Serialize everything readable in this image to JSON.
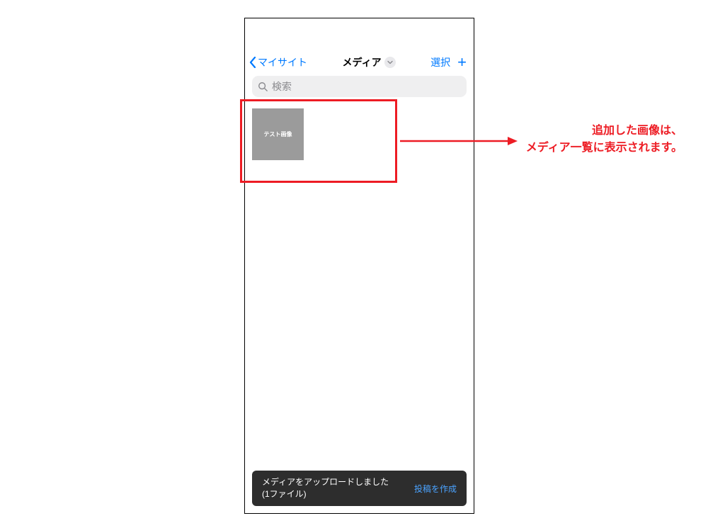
{
  "nav": {
    "back_label": "マイサイト",
    "title": "メディア",
    "select_label": "選択"
  },
  "search": {
    "placeholder": "検索"
  },
  "media": {
    "items": [
      {
        "thumb_label": "テスト画像"
      }
    ]
  },
  "toast": {
    "message_line1": "メディアをアップロードしました",
    "message_line2": "(1ファイル)",
    "action_label": "投稿を作成"
  },
  "annotation": {
    "line1": "追加した画像は、",
    "line2": "メディア一覧に表示されます。"
  }
}
